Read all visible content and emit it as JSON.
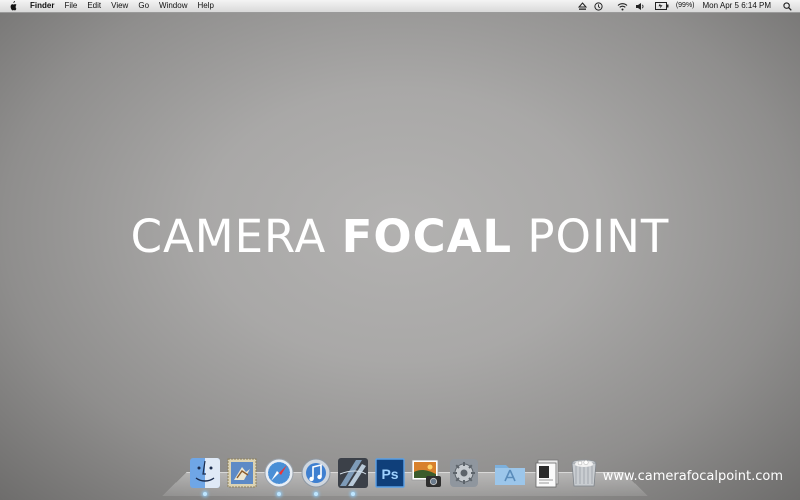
{
  "menubar": {
    "app_name": "Finder",
    "items": [
      "File",
      "Edit",
      "View",
      "Go",
      "Window",
      "Help"
    ],
    "status": {
      "battery_label": "(99%)",
      "clock": "Mon Apr 5  6:14 PM"
    },
    "icons": [
      "apple-icon",
      "eject-icon",
      "time-machine-icon",
      "wifi-icon",
      "volume-icon",
      "battery-icon",
      "spotlight-icon"
    ]
  },
  "desktop": {
    "title_part1": "CAMERA ",
    "title_part2": "FOCAL",
    "title_part3": " POINT",
    "watermark": "www.camerafocalpoint.com"
  },
  "dock": {
    "apps": [
      {
        "name": "finder",
        "running": true
      },
      {
        "name": "mail"
      },
      {
        "name": "safari",
        "running": true
      },
      {
        "name": "itunes",
        "running": true
      },
      {
        "name": "aperture",
        "running": true
      },
      {
        "name": "photoshop"
      },
      {
        "name": "iphoto"
      },
      {
        "name": "system-preferences"
      },
      {
        "name": "applications-folder"
      },
      {
        "name": "documents-stack"
      },
      {
        "name": "trash"
      }
    ],
    "photoshop_label": "Ps"
  }
}
